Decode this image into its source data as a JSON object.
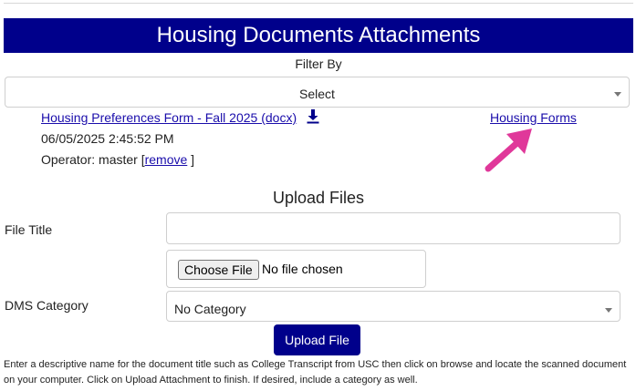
{
  "page": {
    "title": "Housing Documents Attachments"
  },
  "filter": {
    "label": "Filter By",
    "selected": "Select"
  },
  "attachment": {
    "name": "Housing Preferences Form - Fall 2025 (docx)",
    "category_link": "Housing Forms",
    "timestamp": "06/05/2025 2:45:52 PM",
    "operator_prefix": "Operator: master [",
    "remove_label": "remove",
    "operator_suffix": " ]",
    "download_icon": "download-icon",
    "annotation_arrow_color": "#e0389a"
  },
  "upload": {
    "heading": "Upload Files",
    "file_title_label": "File Title",
    "file_title_value": "",
    "choose_file_label": "Choose File",
    "no_file_text": "No file chosen",
    "dms_category_label": "DMS Category",
    "dms_category_selected": "No Category",
    "upload_button_label": "Upload File",
    "help_text": "Enter a descriptive name for the document title such as College Transcript from USC then click on browse and locate the scanned document on your computer. Click on Upload Attachment to finish. If desired, include a category as well."
  },
  "colors": {
    "primary": "#00008b",
    "link": "#1a0dab"
  }
}
